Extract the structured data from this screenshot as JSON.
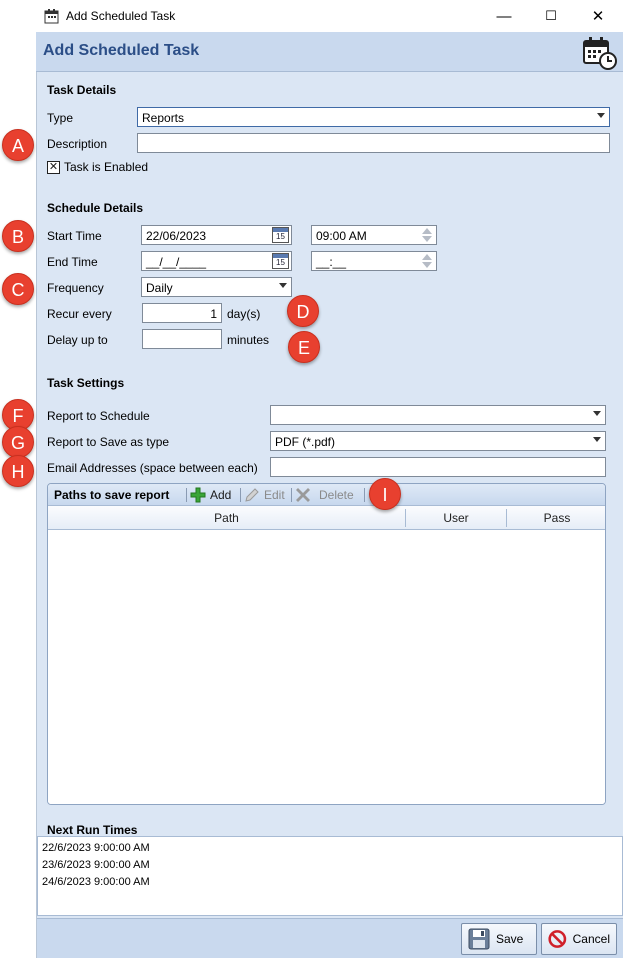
{
  "window": {
    "title": "Add Scheduled Task",
    "minimize": "—",
    "maximize": "☐",
    "close": "✕"
  },
  "header": {
    "title": "Add Scheduled Task",
    "icon": "calendar-clock-icon"
  },
  "task_details": {
    "heading": "Task Details",
    "type_label": "Type",
    "type_value": "Reports",
    "description_label": "Description",
    "description_value": "",
    "enabled_label": "Task is Enabled",
    "enabled_checked": true
  },
  "schedule_details": {
    "heading": "Schedule Details",
    "start_label": "Start Time",
    "start_date": "22/06/2023",
    "start_time": "09:00  AM",
    "end_label": "End Time",
    "end_date": "__/__/____",
    "end_time": "__:__",
    "frequency_label": "Frequency",
    "frequency_value": "Daily",
    "recur_label": "Recur every",
    "recur_value": "1",
    "recur_unit": "day(s)",
    "delay_label": "Delay up to",
    "delay_value": "",
    "delay_unit": "minutes"
  },
  "task_settings": {
    "heading": "Task Settings",
    "report_label": "Report to Schedule",
    "report_value": "",
    "save_type_label": "Report to Save as type",
    "save_type_value": "PDF (*.pdf)",
    "email_label": "Email Addresses (space between each)",
    "email_value": ""
  },
  "paths": {
    "title": "Paths to save report",
    "add": "Add",
    "edit": "Edit",
    "delete": "Delete",
    "columns": [
      "Path",
      "User",
      "Pass"
    ],
    "rows": []
  },
  "next_runs": {
    "heading": "Next Run Times",
    "items": [
      "22/6/2023 9:00:00 AM",
      "23/6/2023 9:00:00 AM",
      "24/6/2023 9:00:00 AM"
    ]
  },
  "footer": {
    "save": "Save",
    "cancel": "Cancel"
  },
  "annotations": [
    "A",
    "B",
    "C",
    "D",
    "E",
    "F",
    "G",
    "H",
    "I"
  ],
  "colors": {
    "accent": "#2b4e87",
    "badge": "#e8402f",
    "panel": "#dbe6f4",
    "header": "#c9d9ee"
  }
}
